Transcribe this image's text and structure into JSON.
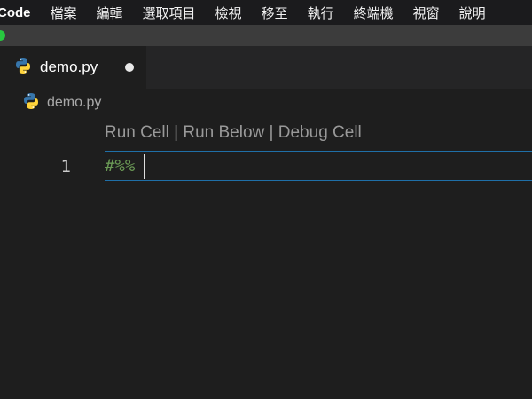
{
  "menubar": {
    "app_name": "Code",
    "items": [
      "檔案",
      "編輯",
      "選取項目",
      "檢視",
      "移至",
      "執行",
      "終端機",
      "視窗",
      "說明"
    ]
  },
  "tab": {
    "label": "demo.py",
    "icon": "python-icon",
    "dirty": true
  },
  "breadcrumb": {
    "label": "demo.py",
    "icon": "python-icon"
  },
  "editor": {
    "codelens": {
      "run_cell": "Run Cell",
      "separator": "|",
      "run_below": "Run Below",
      "debug_cell": "Debug Cell"
    },
    "lines": [
      {
        "number": "1",
        "text": "#%%"
      }
    ]
  },
  "colors": {
    "comment": "#6a9955",
    "python_blue": "#3776ab",
    "python_yellow": "#ffd43b",
    "current_line_border": "#1f6fa8"
  }
}
